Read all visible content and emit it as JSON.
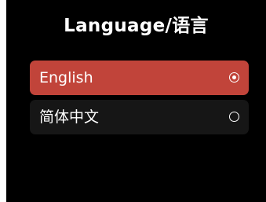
{
  "screen": {
    "title": "Language/语言",
    "accent_color": "#c1443a",
    "background_color": "#000000"
  },
  "options": [
    {
      "label": "English",
      "selected": true
    },
    {
      "label": "简体中文",
      "selected": false
    }
  ]
}
